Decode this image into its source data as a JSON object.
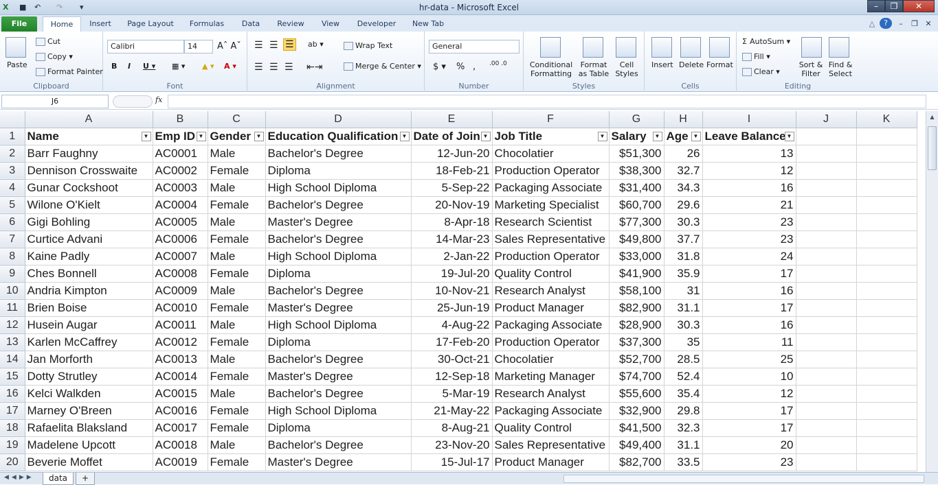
{
  "window": {
    "title": "hr-data  -  Microsoft Excel"
  },
  "tabs": [
    "File",
    "Home",
    "Insert",
    "Page Layout",
    "Formulas",
    "Data",
    "Review",
    "View",
    "Developer",
    "New Tab"
  ],
  "ribbon": {
    "clipboard": {
      "label": "Clipboard",
      "paste": "Paste",
      "cut": "Cut",
      "copy": "Copy",
      "format_painter": "Format Painter"
    },
    "font": {
      "label": "Font",
      "name": "Calibri",
      "size": "14"
    },
    "alignment": {
      "label": "Alignment",
      "wrap": "Wrap Text",
      "merge": "Merge & Center"
    },
    "number": {
      "label": "Number",
      "format": "General"
    },
    "styles": {
      "label": "Styles",
      "conditional": "Conditional Formatting",
      "format_table": "Format as Table",
      "cell_styles": "Cell Styles"
    },
    "cells": {
      "label": "Cells",
      "insert": "Insert",
      "delete": "Delete",
      "format": "Format"
    },
    "editing": {
      "label": "Editing",
      "autosum": "AutoSum",
      "fill": "Fill",
      "clear": "Clear",
      "sort": "Sort & Filter",
      "find": "Find & Select"
    }
  },
  "namebox": "J6",
  "fx": "fx",
  "columns": [
    "A",
    "B",
    "C",
    "D",
    "E",
    "F",
    "G",
    "H",
    "I",
    "J",
    "K"
  ],
  "headers": [
    "Name",
    "Emp ID",
    "Gender",
    "Education Qualification",
    "Date of Join",
    "Job Title",
    "Salary",
    "Age",
    "Leave Balance"
  ],
  "rows": [
    [
      "Barr Faughny",
      "AC0001",
      "Male",
      "Bachelor's Degree",
      "12-Jun-20",
      "Chocolatier",
      "$51,300",
      "26",
      "13"
    ],
    [
      "Dennison Crosswaite",
      "AC0002",
      "Female",
      "Diploma",
      "18-Feb-21",
      "Production Operator",
      "$38,300",
      "32.7",
      "12"
    ],
    [
      "Gunar Cockshoot",
      "AC0003",
      "Male",
      "High School Diploma",
      "5-Sep-22",
      "Packaging Associate",
      "$31,400",
      "34.3",
      "16"
    ],
    [
      "Wilone O'Kielt",
      "AC0004",
      "Female",
      "Bachelor's Degree",
      "20-Nov-19",
      "Marketing Specialist",
      "$60,700",
      "29.6",
      "21"
    ],
    [
      "Gigi Bohling",
      "AC0005",
      "Male",
      "Master's Degree",
      "8-Apr-18",
      "Research Scientist",
      "$77,300",
      "30.3",
      "23"
    ],
    [
      "Curtice Advani",
      "AC0006",
      "Female",
      "Bachelor's Degree",
      "14-Mar-23",
      "Sales Representative",
      "$49,800",
      "37.7",
      "23"
    ],
    [
      "Kaine Padly",
      "AC0007",
      "Male",
      "High School Diploma",
      "2-Jan-22",
      "Production Operator",
      "$33,000",
      "31.8",
      "24"
    ],
    [
      "Ches Bonnell",
      "AC0008",
      "Female",
      "Diploma",
      "19-Jul-20",
      "Quality Control",
      "$41,900",
      "35.9",
      "17"
    ],
    [
      "Andria Kimpton",
      "AC0009",
      "Male",
      "Bachelor's Degree",
      "10-Nov-21",
      "Research Analyst",
      "$58,100",
      "31",
      "16"
    ],
    [
      "Brien Boise",
      "AC0010",
      "Female",
      "Master's Degree",
      "25-Jun-19",
      "Product Manager",
      "$82,900",
      "31.1",
      "17"
    ],
    [
      "Husein Augar",
      "AC0011",
      "Male",
      "High School Diploma",
      "4-Aug-22",
      "Packaging Associate",
      "$28,900",
      "30.3",
      "16"
    ],
    [
      "Karlen McCaffrey",
      "AC0012",
      "Female",
      "Diploma",
      "17-Feb-20",
      "Production Operator",
      "$37,300",
      "35",
      "11"
    ],
    [
      "Jan Morforth",
      "AC0013",
      "Male",
      "Bachelor's Degree",
      "30-Oct-21",
      "Chocolatier",
      "$52,700",
      "28.5",
      "25"
    ],
    [
      "Dotty Strutley",
      "AC0014",
      "Female",
      "Master's Degree",
      "12-Sep-18",
      "Marketing Manager",
      "$74,700",
      "52.4",
      "10"
    ],
    [
      "Kelci Walkden",
      "AC0015",
      "Male",
      "Bachelor's Degree",
      "5-Mar-19",
      "Research Analyst",
      "$55,600",
      "35.4",
      "12"
    ],
    [
      "Marney O'Breen",
      "AC0016",
      "Female",
      "High School Diploma",
      "21-May-22",
      "Packaging Associate",
      "$32,900",
      "29.8",
      "17"
    ],
    [
      "Rafaelita Blaksland",
      "AC0017",
      "Female",
      "Diploma",
      "8-Aug-21",
      "Quality Control",
      "$41,500",
      "32.3",
      "17"
    ],
    [
      "Madelene Upcott",
      "AC0018",
      "Male",
      "Bachelor's Degree",
      "23-Nov-20",
      "Sales Representative",
      "$49,400",
      "31.1",
      "20"
    ],
    [
      "Beverie Moffet",
      "AC0019",
      "Female",
      "Master's Degree",
      "15-Jul-17",
      "Product Manager",
      "$82,700",
      "33.5",
      "23"
    ]
  ],
  "sheets": [
    "data"
  ]
}
